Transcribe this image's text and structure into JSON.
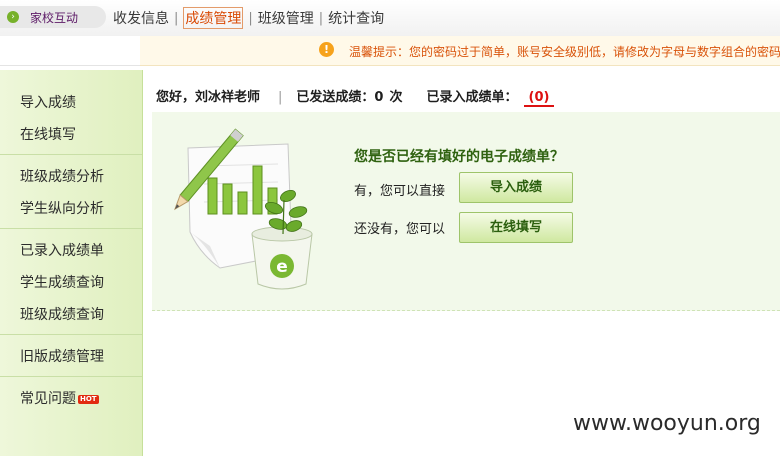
{
  "nav": {
    "brand": "家校互动",
    "items": [
      "收发信息",
      "成绩管理",
      "班级管理",
      "统计查询"
    ],
    "separator": "|",
    "active_index": 1
  },
  "warning": {
    "icon": "exclamation-icon",
    "text": "温馨提示：您的密码过于简单，账号安全级别低，请修改为字母与数字组合的密码"
  },
  "sidebar": {
    "items": [
      "导入成绩",
      "在线填写",
      "班级成绩分析",
      "学生纵向分析",
      "已录入成绩单",
      "学生成绩查询",
      "班级成绩查询",
      "旧版成绩管理",
      "常见问题"
    ],
    "hot_badge": "HOT"
  },
  "header": {
    "greeting": "您好，刘冰祥老师",
    "separator": "|",
    "sent_label": "已发送成绩：",
    "sent_count": "0",
    "sent_unit": "次",
    "recorded_label": "已录入成绩单：",
    "recorded_count": "(0)"
  },
  "panel": {
    "question": "您是否已经有填好的电子成绩单？",
    "option_yes_text": "有，您可以直接",
    "import_button": "导入成绩",
    "option_no_text": "还没有，您可以",
    "online_button": "在线填写",
    "illustration_letter": "e"
  },
  "watermark": "www.wooyun.org",
  "colors": {
    "brand_purple": "#5d1a67",
    "active_orange": "#d94a05",
    "warning_text": "#d9530a",
    "sidebar_green": "#e0f0bf",
    "button_text": "#2b5f0e",
    "recorded_red": "#dd1111"
  }
}
